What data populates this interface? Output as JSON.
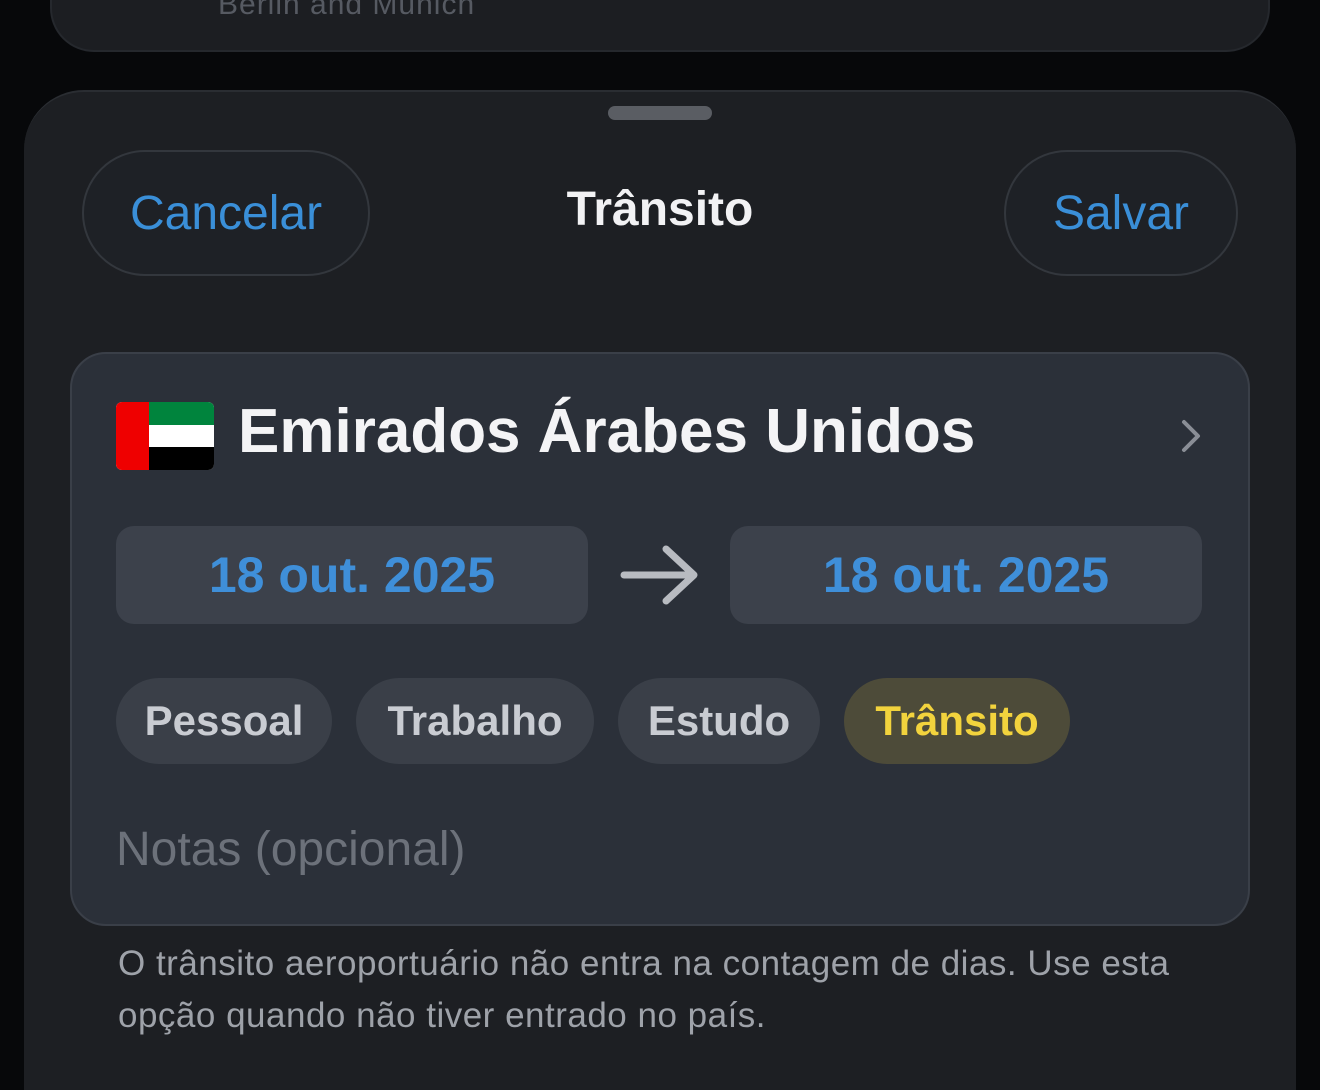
{
  "background_card": {
    "text": "Berlin and Munich"
  },
  "header": {
    "cancel_label": "Cancelar",
    "title": "Trânsito",
    "save_label": "Salvar"
  },
  "country": {
    "name": "Emirados Árabes Unidos",
    "flag_icon": "uae-flag-icon"
  },
  "dates": {
    "start": "18 out. 2025",
    "end": "18 out. 2025"
  },
  "categories": [
    {
      "label": "Pessoal",
      "selected": false
    },
    {
      "label": "Trabalho",
      "selected": false
    },
    {
      "label": "Estudo",
      "selected": false
    },
    {
      "label": "Trânsito",
      "selected": true
    }
  ],
  "notes": {
    "value": "",
    "placeholder": "Notas (opcional)"
  },
  "footnote": "O trânsito aeroportuário não entra na contagem de dias. Use esta opção quando não tiver entrado no país.",
  "colors": {
    "accent_blue": "#3a8fd8",
    "selected_chip_text": "#f2d33d",
    "selected_chip_bg": "#4d4b39",
    "card_bg": "#2b3039",
    "sheet_bg": "#1d1f23"
  }
}
